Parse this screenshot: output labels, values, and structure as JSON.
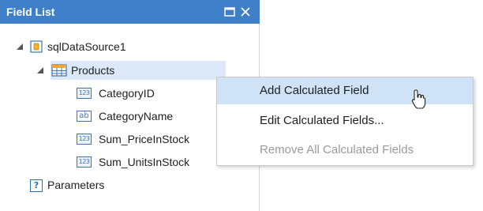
{
  "panel": {
    "title": "Field List",
    "colors": {
      "titlebar": "#3f7fc7",
      "selection": "#dbe9f8",
      "menu_hover": "#cfe2f6"
    }
  },
  "tree": {
    "datasource": {
      "label": "sqlDataSource1",
      "icon": "database-icon"
    },
    "table": {
      "label": "Products",
      "icon": "table-icon"
    },
    "fields": [
      {
        "label": "CategoryID",
        "type_icon": "123"
      },
      {
        "label": "CategoryName",
        "type_icon": "ab"
      },
      {
        "label": "Sum_PriceInStock",
        "type_icon": "123"
      },
      {
        "label": "Sum_UnitsInStock",
        "type_icon": "123"
      }
    ],
    "parameters": {
      "label": "Parameters",
      "icon": "?"
    }
  },
  "context_menu": {
    "items": [
      {
        "label": "Add Calculated Field",
        "state": "hovered"
      },
      {
        "label": "Edit Calculated Fields...",
        "state": "normal"
      },
      {
        "label": "Remove All Calculated Fields",
        "state": "disabled"
      }
    ]
  }
}
